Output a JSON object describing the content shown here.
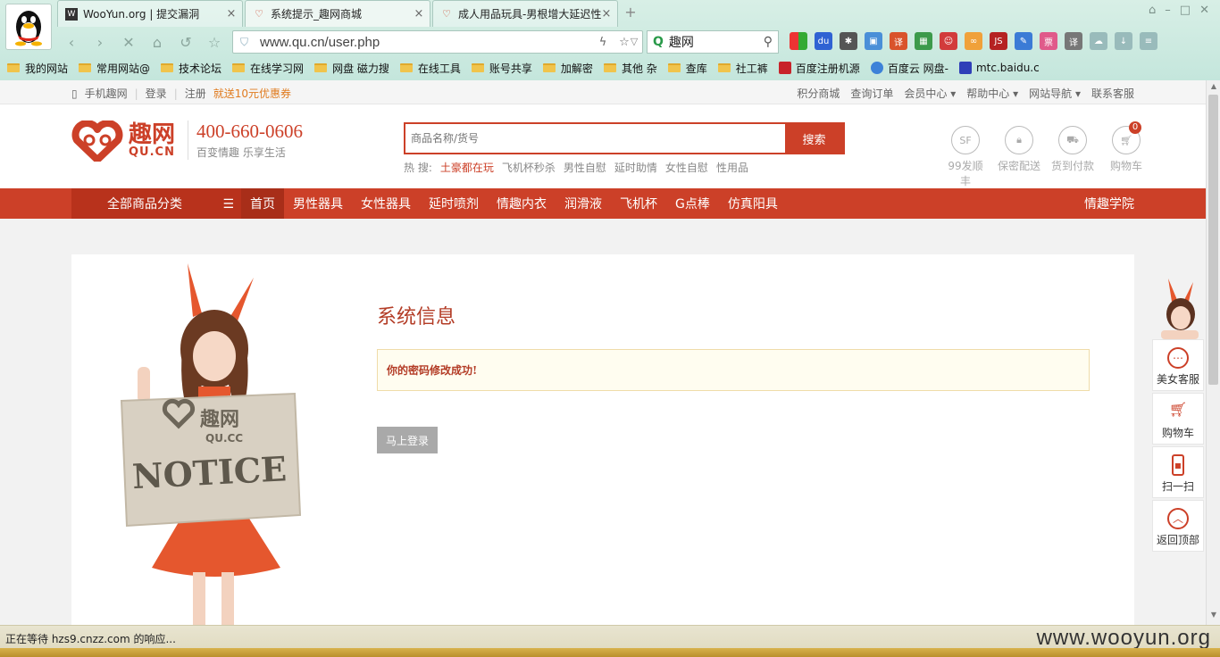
{
  "browser": {
    "tabs": [
      {
        "label": "WooYun.org | 提交漏洞",
        "active": false,
        "close": "×"
      },
      {
        "label": "系统提示_趣网商城",
        "active": true,
        "close": "×"
      },
      {
        "label": "成人用品玩具-男根增大延迟性",
        "active": false,
        "close": "×"
      }
    ],
    "new_tab": "+",
    "address": "www.qu.cn/user.php",
    "search_value": "趣网",
    "bookmarks": [
      "我的网站",
      "常用网站@",
      "技术论坛",
      "在线学习网",
      "网盘 磁力搜",
      "在线工具",
      "账号共享",
      "加解密",
      "其他 杂",
      "查库",
      "社工裤",
      "百度注册机源",
      "百度云 网盘-",
      "mtc.baidu.c"
    ],
    "status_text": "正在等待 hzs9.cnzz.com 的响应...",
    "watermark": "www.wooyun.org"
  },
  "site": {
    "topbar": {
      "mobile": "手机趣网",
      "login": "登录",
      "register": "注册",
      "promo": "就送10元优惠券",
      "links": [
        "积分商城",
        "查询订单",
        "会员中心",
        "帮助中心",
        "网站导航",
        "联系客服"
      ]
    },
    "logo": {
      "cn": "趣网",
      "en": "QU.CN"
    },
    "hotline": {
      "number": "400-660-0606",
      "slogan": "百变情趣  乐享生活"
    },
    "search": {
      "placeholder": "商品名称/货号",
      "button": "搜索"
    },
    "hotwords": {
      "label": "热 搜:",
      "items": [
        "土豪都在玩",
        "飞机杯秒杀",
        "男性自慰",
        "延时助情",
        "女性自慰",
        "性用品"
      ]
    },
    "services": [
      {
        "icon": "SF",
        "label": "99发顺丰"
      },
      {
        "icon": "lock",
        "label": "保密配送"
      },
      {
        "icon": "car",
        "label": "货到付款"
      },
      {
        "icon": "cart",
        "label": "购物车",
        "badge": "0"
      }
    ],
    "nav": {
      "all_categories": "全部商品分类",
      "items": [
        "首页",
        "男性器具",
        "女性器具",
        "延时喷剂",
        "情趣内衣",
        "润滑液",
        "飞机杯",
        "G点棒",
        "仿真阳具"
      ],
      "right": "情趣学院"
    },
    "notice": {
      "title": "系统信息",
      "message": "你的密码修改成功!",
      "button": "马上登录",
      "sign_brand": "趣网",
      "sign_domain": "QU.CC",
      "sign_word": "NOTICE"
    },
    "float": [
      "美女客服",
      "购物车",
      "扫一扫",
      "返回顶部"
    ]
  },
  "colors": {
    "brand": "#cc4028",
    "chrome": "#c4e6dc"
  }
}
